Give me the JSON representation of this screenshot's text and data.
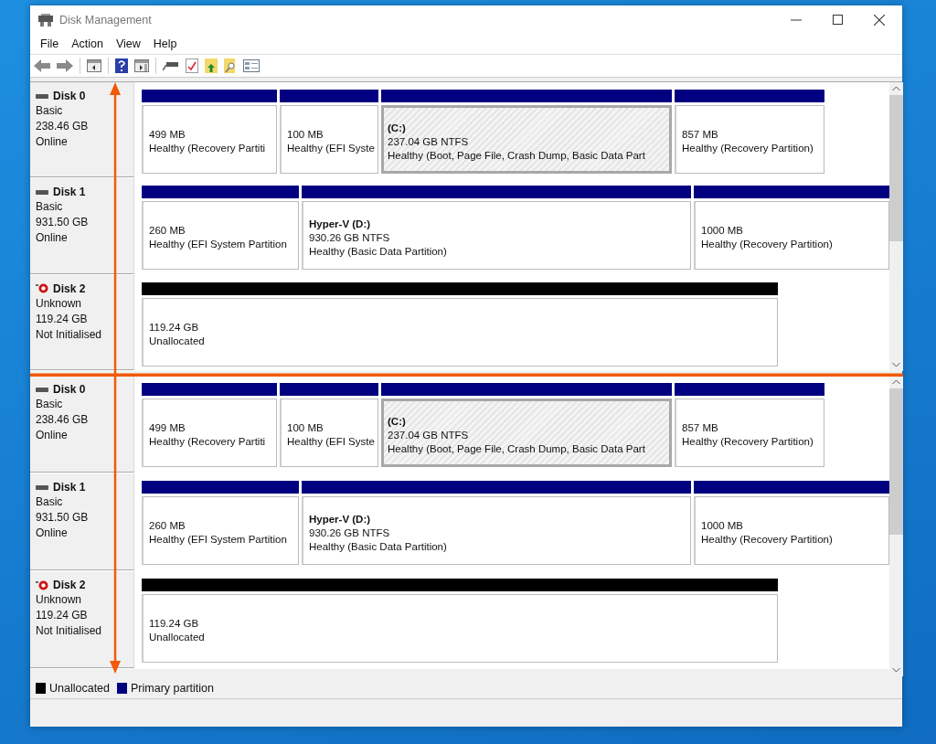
{
  "window": {
    "title": "Disk Management"
  },
  "menu": [
    "File",
    "Action",
    "View",
    "Help"
  ],
  "panes": [
    {
      "disks": [
        {
          "name": "Disk 0",
          "type": "Basic",
          "size": "238.46 GB",
          "status": "Online",
          "error": false,
          "partitions": [
            {
              "kind": "primary",
              "selected": false,
              "size": "499 MB",
              "status": "Healthy (Recovery Partiti"
            },
            {
              "kind": "primary",
              "selected": false,
              "size": "100 MB",
              "status": "Healthy (EFI Syste"
            },
            {
              "kind": "primary",
              "selected": true,
              "label": "(C:)",
              "size": "237.04 GB NTFS",
              "status": "Healthy (Boot, Page File, Crash Dump, Basic Data Part"
            },
            {
              "kind": "primary",
              "selected": false,
              "size": "857 MB",
              "status": "Healthy (Recovery Partition)"
            }
          ]
        },
        {
          "name": "Disk 1",
          "type": "Basic",
          "size": "931.50 GB",
          "status": "Online",
          "error": false,
          "partitions": [
            {
              "kind": "primary",
              "selected": false,
              "size": "260 MB",
              "status": "Healthy (EFI System Partition"
            },
            {
              "kind": "primary",
              "selected": false,
              "label": "Hyper-V  (D:)",
              "size": "930.26 GB NTFS",
              "status": "Healthy (Basic Data Partition)"
            },
            {
              "kind": "primary",
              "selected": false,
              "size": "1000 MB",
              "status": "Healthy (Recovery Partition)"
            }
          ]
        },
        {
          "name": "Disk 2",
          "type": "Unknown",
          "size": "119.24 GB",
          "status": "Not Initialised",
          "error": true,
          "partitions": [
            {
              "kind": "unallocated",
              "selected": false,
              "size": "119.24 GB",
              "status": "Unallocated"
            }
          ]
        }
      ]
    },
    {
      "disks": [
        {
          "name": "Disk 0",
          "type": "Basic",
          "size": "238.46 GB",
          "status": "Online",
          "error": false,
          "partitions": [
            {
              "kind": "primary",
              "selected": false,
              "size": "499 MB",
              "status": "Healthy (Recovery Partiti"
            },
            {
              "kind": "primary",
              "selected": false,
              "size": "100 MB",
              "status": "Healthy (EFI Syste"
            },
            {
              "kind": "primary",
              "selected": true,
              "label": "(C:)",
              "size": "237.04 GB NTFS",
              "status": "Healthy (Boot, Page File, Crash Dump, Basic Data Part"
            },
            {
              "kind": "primary",
              "selected": false,
              "size": "857 MB",
              "status": "Healthy (Recovery Partition)"
            }
          ]
        },
        {
          "name": "Disk 1",
          "type": "Basic",
          "size": "931.50 GB",
          "status": "Online",
          "error": false,
          "partitions": [
            {
              "kind": "primary",
              "selected": false,
              "size": "260 MB",
              "status": "Healthy (EFI System Partition"
            },
            {
              "kind": "primary",
              "selected": false,
              "label": "Hyper-V  (D:)",
              "size": "930.26 GB NTFS",
              "status": "Healthy (Basic Data Partition)"
            },
            {
              "kind": "primary",
              "selected": false,
              "size": "1000 MB",
              "status": "Healthy (Recovery Partition)"
            }
          ]
        },
        {
          "name": "Disk 2",
          "type": "Unknown",
          "size": "119.24 GB",
          "status": "Not Initialised",
          "error": true,
          "partitions": [
            {
              "kind": "unallocated",
              "selected": false,
              "size": "119.24 GB",
              "status": "Unallocated"
            }
          ]
        }
      ]
    }
  ],
  "legend": [
    {
      "label": "Unallocated",
      "color": "#000000"
    },
    {
      "label": "Primary partition",
      "color": "#000080"
    }
  ]
}
